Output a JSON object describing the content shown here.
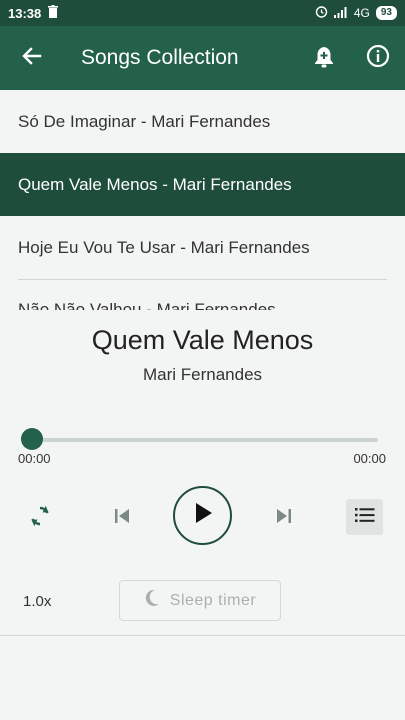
{
  "status_bar": {
    "time": "13:38",
    "network": "4G",
    "battery": "93"
  },
  "app_bar": {
    "title": "Songs Collection"
  },
  "songs": [
    {
      "label": "Só De Imaginar - Mari Fernandes"
    },
    {
      "label": "Quem Vale Menos - Mari Fernandes"
    },
    {
      "label": "Hoje Eu Vou Te Usar - Mari Fernandes"
    },
    {
      "label": "Não Não Valhou - Mari Fernandes"
    }
  ],
  "player": {
    "title": "Quem Vale Menos",
    "artist": "Mari Fernandes",
    "position_fraction": 0.0,
    "time_current": "00:00",
    "time_total": "00:00",
    "speed": "1.0x",
    "sleep_timer_label": "Sleep timer"
  },
  "colors": {
    "primary": "#24614a",
    "primary_dark": "#1f4d3c",
    "background": "#f3f5f4"
  },
  "icons": {
    "back": "arrow-left-icon",
    "alarm_add": "bell-plus-icon",
    "info": "info-icon",
    "repeat": "repeat-icon",
    "previous": "skip-previous-icon",
    "play": "play-icon",
    "next": "skip-next-icon",
    "queue": "list-icon",
    "moon": "moon-icon"
  }
}
